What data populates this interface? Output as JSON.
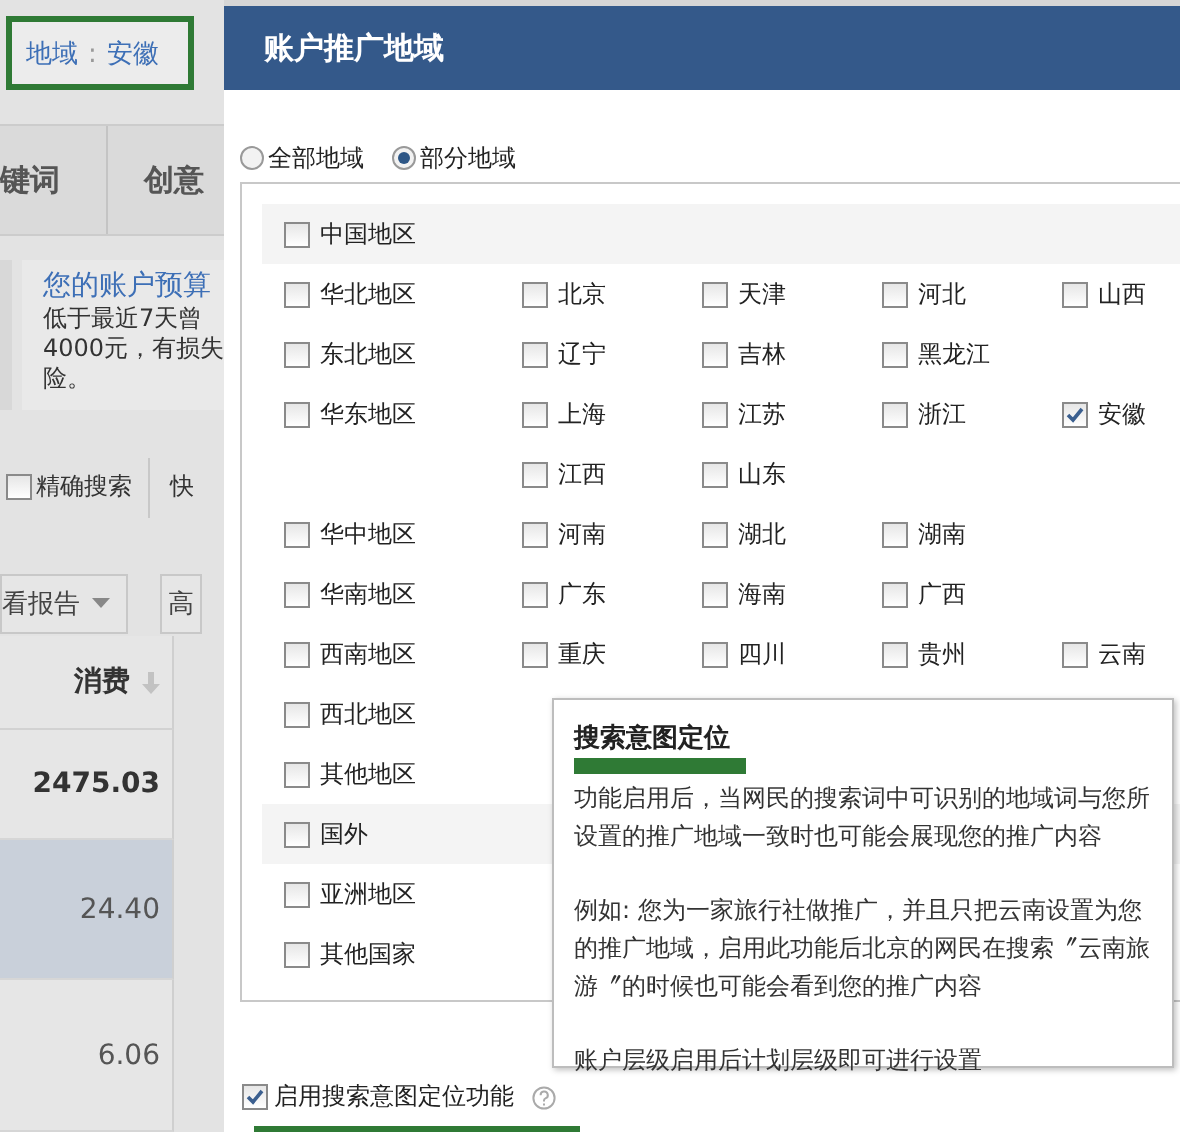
{
  "background_page": {
    "region_filter": {
      "label": "地域",
      "separator": ":",
      "value": "安徽"
    },
    "tabs": [
      {
        "label": "键词",
        "selected": false
      },
      {
        "label": "创意",
        "selected": false
      }
    ],
    "budget_notice": {
      "title": "您的账户预算",
      "lines": [
        "低于最近7天曾",
        "4000元，有损失",
        "险。"
      ]
    },
    "exact_search": {
      "label": "精确搜索",
      "checked": false
    },
    "toolbar_text": "快",
    "report_button": "看报告",
    "advanced_button": "高",
    "table": {
      "columns": [
        "消费"
      ],
      "rows": [
        {
          "cells": [
            "2475.03"
          ],
          "kind": "total",
          "selected": false
        },
        {
          "cells": [
            "24.40"
          ],
          "kind": "item",
          "selected": true
        },
        {
          "cells": [
            "6.06"
          ],
          "kind": "item",
          "selected": false
        }
      ]
    }
  },
  "dialog": {
    "title": "账户推广地域",
    "scope_options": [
      {
        "label": "全部地域",
        "selected": false
      },
      {
        "label": "部分地域",
        "selected": true
      }
    ],
    "regions": [
      {
        "kind": "header",
        "label": "中国地区",
        "checked": false
      },
      {
        "kind": "group",
        "label": "华北地区",
        "checked": false,
        "provinces": [
          {
            "label": "北京",
            "checked": false
          },
          {
            "label": "天津",
            "checked": false
          },
          {
            "label": "河北",
            "checked": false
          },
          {
            "label": "山西",
            "checked": false
          }
        ]
      },
      {
        "kind": "group",
        "label": "东北地区",
        "checked": false,
        "provinces": [
          {
            "label": "辽宁",
            "checked": false
          },
          {
            "label": "吉林",
            "checked": false
          },
          {
            "label": "黑龙江",
            "checked": false
          }
        ]
      },
      {
        "kind": "group",
        "label": "华东地区",
        "checked": false,
        "provinces": [
          {
            "label": "上海",
            "checked": false
          },
          {
            "label": "江苏",
            "checked": false
          },
          {
            "label": "浙江",
            "checked": false
          },
          {
            "label": "安徽",
            "checked": true
          },
          {
            "label": "江西",
            "checked": false
          },
          {
            "label": "山东",
            "checked": false
          }
        ]
      },
      {
        "kind": "group",
        "label": "华中地区",
        "checked": false,
        "provinces": [
          {
            "label": "河南",
            "checked": false
          },
          {
            "label": "湖北",
            "checked": false
          },
          {
            "label": "湖南",
            "checked": false
          }
        ]
      },
      {
        "kind": "group",
        "label": "华南地区",
        "checked": false,
        "provinces": [
          {
            "label": "广东",
            "checked": false
          },
          {
            "label": "海南",
            "checked": false
          },
          {
            "label": "广西",
            "checked": false
          }
        ]
      },
      {
        "kind": "group",
        "label": "西南地区",
        "checked": false,
        "provinces": [
          {
            "label": "重庆",
            "checked": false
          },
          {
            "label": "四川",
            "checked": false
          },
          {
            "label": "贵州",
            "checked": false
          },
          {
            "label": "云南",
            "checked": false
          }
        ]
      },
      {
        "kind": "group",
        "label": "西北地区",
        "checked": false
      },
      {
        "kind": "group",
        "label": "其他地区",
        "checked": false
      },
      {
        "kind": "header",
        "label": "国外",
        "checked": false
      },
      {
        "kind": "group",
        "label": "亚洲地区",
        "checked": false
      },
      {
        "kind": "group",
        "label": "其他国家",
        "checked": false
      }
    ],
    "intent_option": {
      "label": "启用搜索意图定位功能",
      "checked": true
    }
  },
  "tooltip": {
    "title": "搜索意图定位",
    "paragraphs": [
      "功能启用后，当网民的搜索词中可识别的地域词与您所设置的推广地域一致时也可能会展现您的推广内容",
      "例如: 您为一家旅行社做推广，并且只把云南设置为您的推广地域，启用此功能后北京的网民在搜索〞云南旅游〞的时候也可能会看到您的推广内容",
      "账户层级启用后计划层级即可进行设置"
    ]
  }
}
